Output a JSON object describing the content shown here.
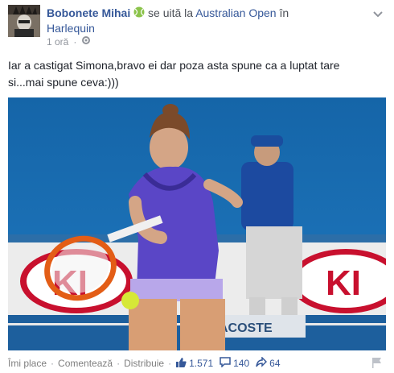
{
  "post": {
    "author": "Bobonete Mihai",
    "activity_prefix": "se uită la",
    "activity_subject": "Australian Open",
    "activity_sep": "în",
    "place": "Harlequin",
    "time": "1 oră",
    "text": "Iar a castigat Simona,bravo ei dar poza asta spune ca a luptat tare si...mai spune ceva:)))"
  },
  "photo": {
    "description_icons": [
      "tennis-player",
      "tennis-racket",
      "tennis-ball",
      "line-judge",
      "kia-ad-board"
    ],
    "ad_text_left": "KI",
    "ad_text_right": "KI",
    "board_text": "ACOSTE"
  },
  "actions": {
    "like_label": "Îmi place",
    "comment_label": "Comentează",
    "share_label": "Distribuie",
    "likes_count": "1.571",
    "comments_count": "140",
    "shares_count": "64"
  },
  "colors": {
    "link": "#365899",
    "court_blue": "#1f6fb0",
    "ad_red": "#c8102e"
  }
}
